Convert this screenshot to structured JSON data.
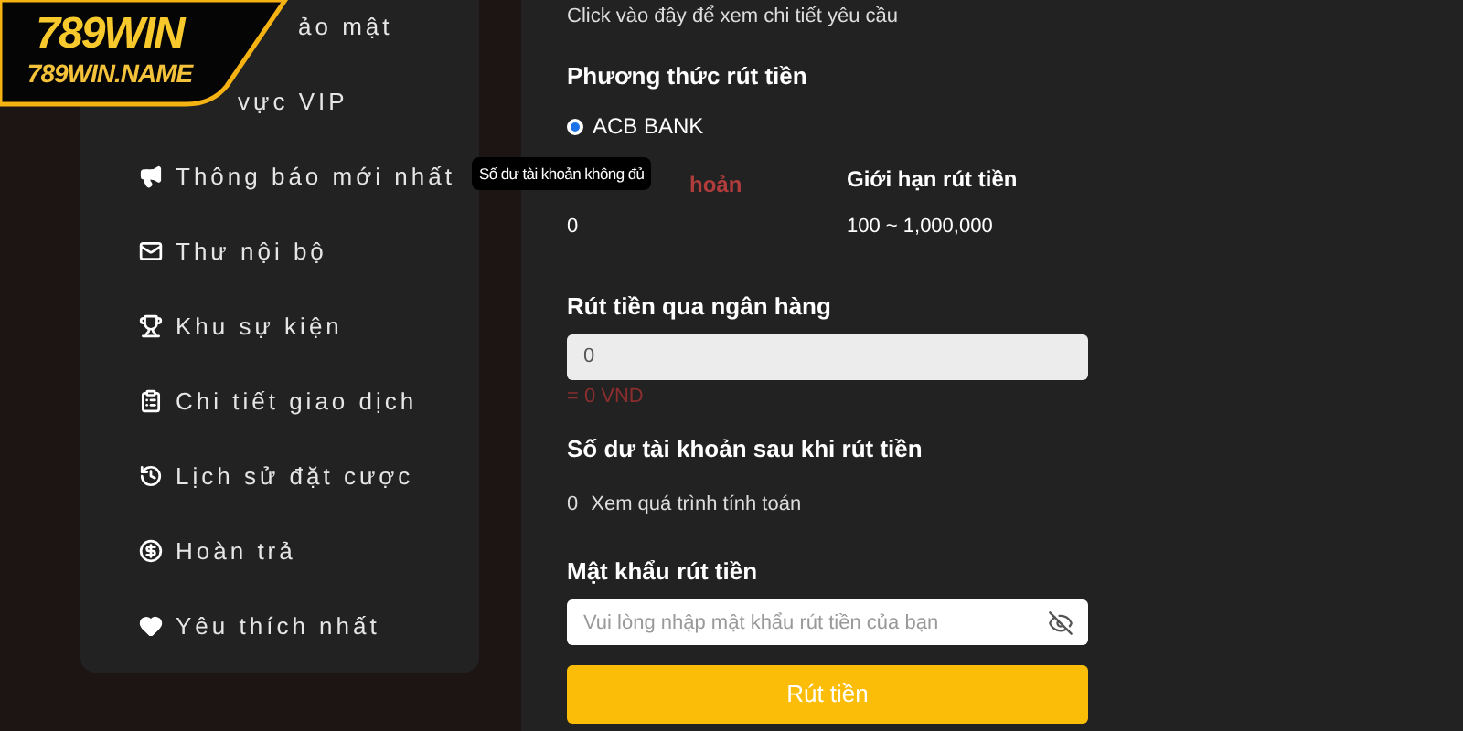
{
  "logo": {
    "line_1": "789WIN",
    "line_2": "789WIN.NAME"
  },
  "sidebar": {
    "items": [
      {
        "label": "ảo mật"
      },
      {
        "label": "vực VIP"
      },
      {
        "label": "Thông báo mới nhất"
      },
      {
        "label": "Thư nội bộ"
      },
      {
        "label": "Khu sự kiện"
      },
      {
        "label": "Chi tiết giao dịch"
      },
      {
        "label": "Lịch sử đặt cược"
      },
      {
        "label": "Hoàn trả"
      },
      {
        "label": "Yêu thích nhất"
      }
    ]
  },
  "form": {
    "hint_link": "Click vào đây để xem chi tiết yêu cầu",
    "method_title": "Phương thức rút tiền",
    "methods": [
      {
        "label": "ACB BANK",
        "selected": true
      }
    ],
    "balance_label": "hoản",
    "balance_value": "0",
    "limit_label": "Giới hạn rút tiền",
    "limit_value": "100 ~ 1,000,000",
    "tooltip": "Số dư tài khoản không đủ",
    "amount_title": "Rút tiền qua ngân hàng",
    "amount_value": "0",
    "amount_converted": "= 0 VND",
    "after_title": "Số dư tài khoản sau khi rút tiền",
    "after_value": "0",
    "after_link": "Xem quá trình tính toán",
    "password_title": "Mật khẩu rút tiền",
    "password_placeholder": "Vui lòng nhập mật khẩu rút tiền của bạn",
    "submit": "Rút tiền"
  }
}
